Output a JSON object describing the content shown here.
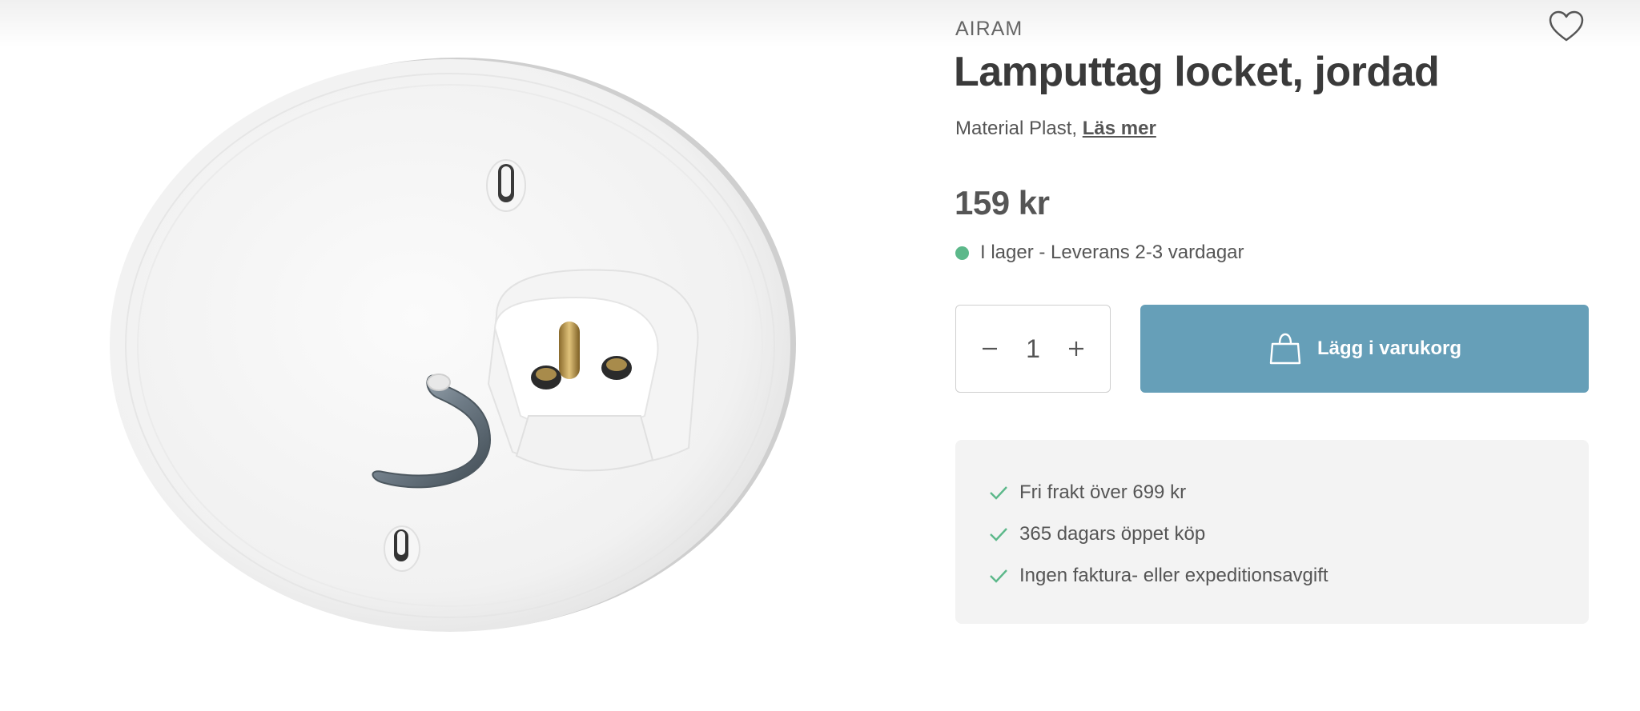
{
  "product": {
    "brand": "AIRAM",
    "title": "Lamputtag locket, jordad",
    "material_text": "Material Plast,",
    "read_more_link": "Läs mer",
    "price": "159 kr",
    "stock_text": "I lager - Leverans 2-3 vardagar",
    "stock_color": "#5cb88a",
    "image_icon": "ceiling-socket-photo"
  },
  "quantity": {
    "value": "1",
    "decrement_icon": "minus-icon",
    "increment_icon": "plus-icon"
  },
  "cart": {
    "label": "Lägg i varukorg",
    "icon": "shopping-bag-icon",
    "color": "#669fb8"
  },
  "favorite": {
    "icon": "heart-icon"
  },
  "usps": [
    {
      "text": "Fri frakt över 699 kr",
      "icon": "check-icon"
    },
    {
      "text": "365 dagars öppet köp",
      "icon": "check-icon"
    },
    {
      "text": "Ingen faktura- eller expeditionsavgift",
      "icon": "check-icon"
    }
  ],
  "colors": {
    "accent": "#669fb8",
    "check": "#5cb88a",
    "usp_background": "#f3f3f3"
  }
}
